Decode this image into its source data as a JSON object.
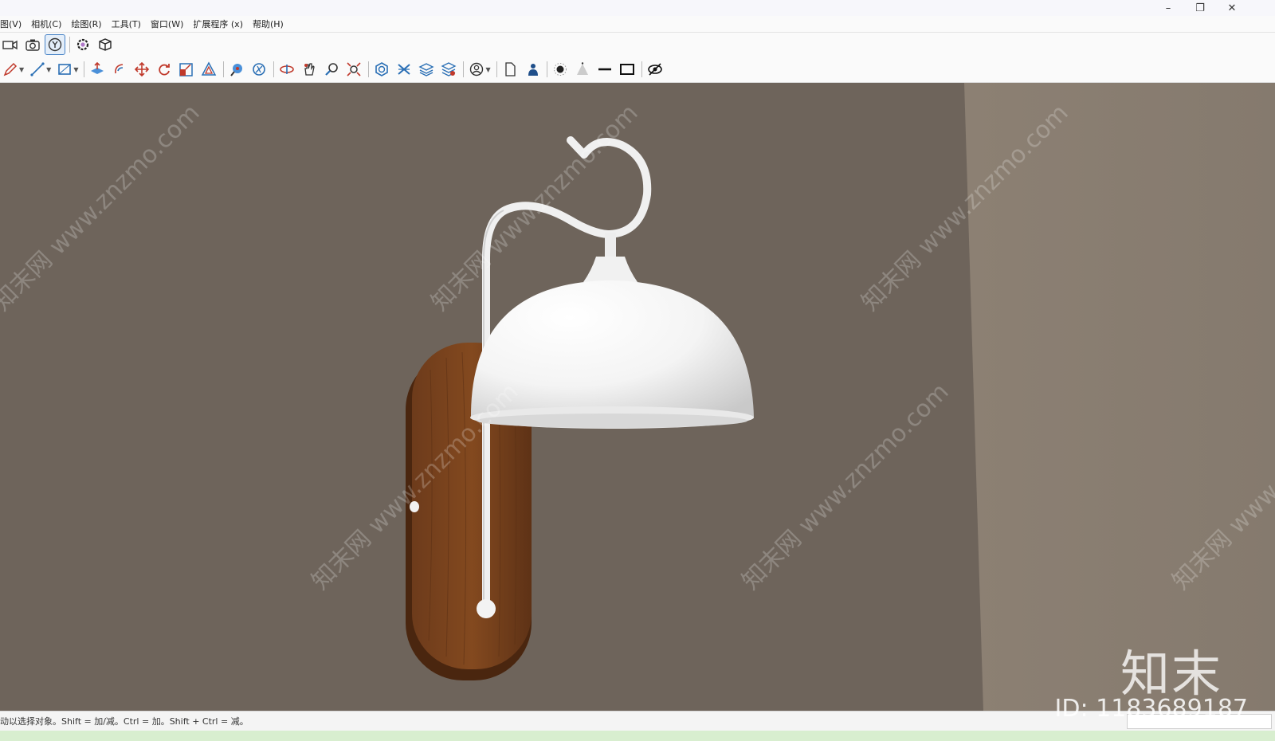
{
  "window": {
    "minimize_glyph": "–",
    "restore_glyph": "❐",
    "close_glyph": "✕"
  },
  "menu": {
    "items": [
      "图(V)",
      "相机(C)",
      "绘图(R)",
      "工具(T)",
      "窗口(W)",
      "扩展程序 (x)",
      "帮助(H)"
    ]
  },
  "toolbar_primary": {
    "icons": [
      "video-camera-icon",
      "camera-icon",
      "style-icon",
      "gear-component-icon",
      "3d-box-icon"
    ]
  },
  "toolbar_secondary": {
    "icons": [
      "pencil-icon",
      "line-icon",
      "rectangle-icon",
      "push-pull-icon",
      "follow-me-icon",
      "move-icon",
      "rotate-icon",
      "scale-icon",
      "offset-icon",
      "tape-measure-icon",
      "protractor-icon",
      "orbit-icon",
      "pan-icon",
      "zoom-icon",
      "zoom-extents-icon",
      "solid-tools-icon",
      "intersect-icon",
      "layers-icon",
      "section-icon",
      "user-account-icon",
      "new-document-icon",
      "person-icon",
      "shadow-icon",
      "fog-icon",
      "edge-icon",
      "face-icon",
      "xray-icon"
    ]
  },
  "viewport": {
    "colors": {
      "wall": "#6e645b",
      "wall_side": "#8a7e72",
      "wood": "#6b3a1c",
      "lamp_white": "#f3f3f3"
    },
    "watermark_text": "知末网 www.znzmo.com"
  },
  "brand": {
    "logo_text": "知末",
    "id_text": "ID: 1183689187"
  },
  "status": {
    "hint": "动以选择对象。Shift = 加/减。Ctrl = 加。Shift + Ctrl = 减。"
  }
}
